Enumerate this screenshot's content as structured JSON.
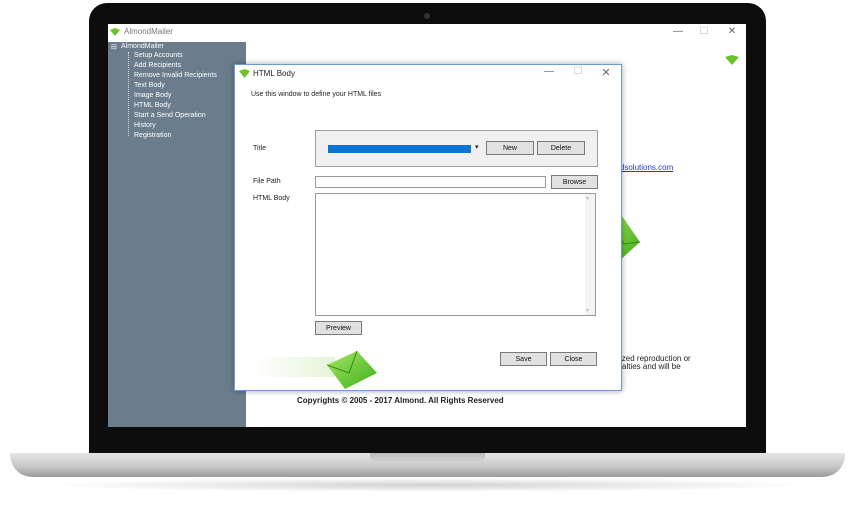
{
  "app": {
    "title": "AlmondMailer",
    "window_controls": {
      "minimize": "—",
      "maximize": "☐",
      "close": "✕"
    }
  },
  "sidebar": {
    "root": "AlmondMailer",
    "items": [
      {
        "label": "Setup Accounts"
      },
      {
        "label": "Add Recipients"
      },
      {
        "label": "Remove Invalid Recipients"
      },
      {
        "label": "Text Body"
      },
      {
        "label": "Image Body"
      },
      {
        "label": "HTML Body"
      },
      {
        "label": "Start a Send Operation"
      },
      {
        "label": "History"
      },
      {
        "label": "Registration"
      }
    ]
  },
  "content": {
    "link_fragment": "ondsolutions.com",
    "text_line1": "ized reproduction or",
    "text_line2": "alties and will be",
    "copyright": "Copyrights © 2005 - 2017 Almond. All Rights Reserved"
  },
  "dialog": {
    "title": "HTML Body",
    "description": "Use this window to define your HTML files",
    "title_label": "Title",
    "file_path_label": "File Path",
    "html_body_label": "HTML Body",
    "buttons": {
      "new": "New",
      "delete": "Delete",
      "browse": "Browse",
      "preview": "Preview",
      "save": "Save",
      "close": "Close"
    },
    "file_path_value": "",
    "html_body_value": ""
  },
  "colors": {
    "sidebar": "#6b7d8c",
    "selection": "#0c74d4",
    "link": "#1a3fd6",
    "accent_green": "#6cc329"
  }
}
